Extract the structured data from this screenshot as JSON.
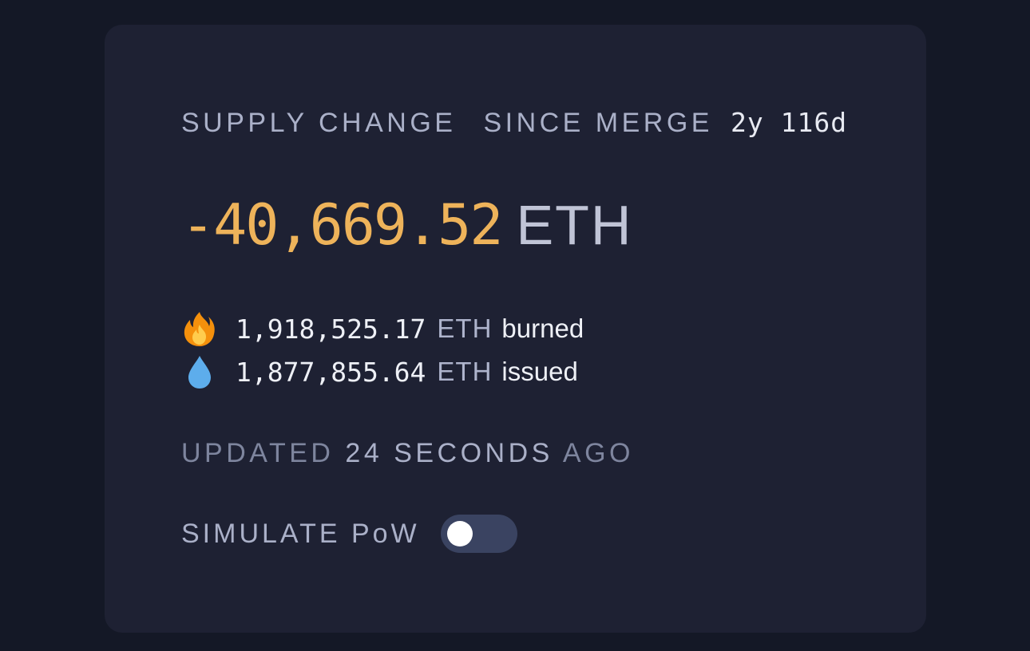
{
  "header": {
    "label": "SUPPLY CHANGE",
    "period": "SINCE MERGE",
    "duration": "2y 116d"
  },
  "supply_change": {
    "value": "-40,669.52",
    "unit": "ETH"
  },
  "burned": {
    "icon": "fire-icon",
    "value": "1,918,525.17",
    "unit": "ETH",
    "label": "burned"
  },
  "issued": {
    "icon": "droplet-icon",
    "value": "1,877,855.64",
    "unit": "ETH",
    "label": "issued"
  },
  "updated": {
    "prefix": "UPDATED",
    "amount": "24",
    "unit": "SECONDS",
    "suffix": "AGO"
  },
  "simulate": {
    "label": "SIMULATE PoW",
    "enabled": false
  },
  "colors": {
    "negative_value": "#eeb35a",
    "card_bg": "#1e2133",
    "page_bg": "#141826",
    "toggle_off": "#3a4361"
  }
}
